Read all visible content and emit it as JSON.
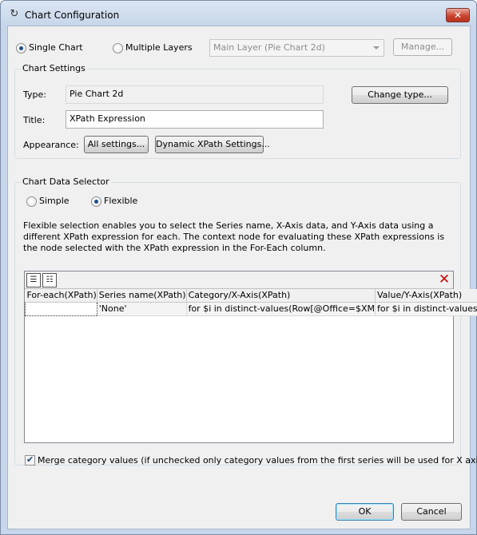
{
  "window": {
    "title": "Chart Configuration",
    "close_label": "✕"
  },
  "mode": {
    "single_label": "Single Chart",
    "multiple_label": "Multiple Layers",
    "selected": "single"
  },
  "layer": {
    "value": "Main Layer (Pie Chart 2d)",
    "manage_label": "Manage..."
  },
  "chart_settings": {
    "group_title": "Chart Settings",
    "type_label": "Type:",
    "type_value": "Pie Chart 2d",
    "change_type_label": "Change type...",
    "title_label": "Title:",
    "title_value": "XPath Expression",
    "appearance_label": "Appearance:",
    "all_settings_label": "All settings...",
    "dynamic_label": "Dynamic XPath Settings..."
  },
  "data_selector": {
    "group_title": "Chart Data Selector",
    "simple_label": "Simple",
    "flexible_label": "Flexible",
    "selected": "flexible",
    "description": "Flexible selection enables you to select the Series name, X-Axis data, and Y-Axis data using a different XPath expression for each. The context node for evaluating these XPath expressions is the node selected with the XPath expression in the For-Each column.",
    "grid": {
      "columns": [
        "For-each(XPath)",
        "Series name(XPath)",
        "Category/X-Axis(XPath)",
        "Value/Y-Axis(XPath)"
      ],
      "rows": [
        [
          "",
          "'None'",
          "for $i in distinct-values(Row[@Office=$XM",
          "for $i in distinct-values(Row"
        ]
      ]
    },
    "merge_label": "Merge category values (if unchecked only category values from the first series will be used for X axis)",
    "merge_checked": true
  },
  "footer": {
    "ok_label": "OK",
    "cancel_label": "Cancel"
  }
}
